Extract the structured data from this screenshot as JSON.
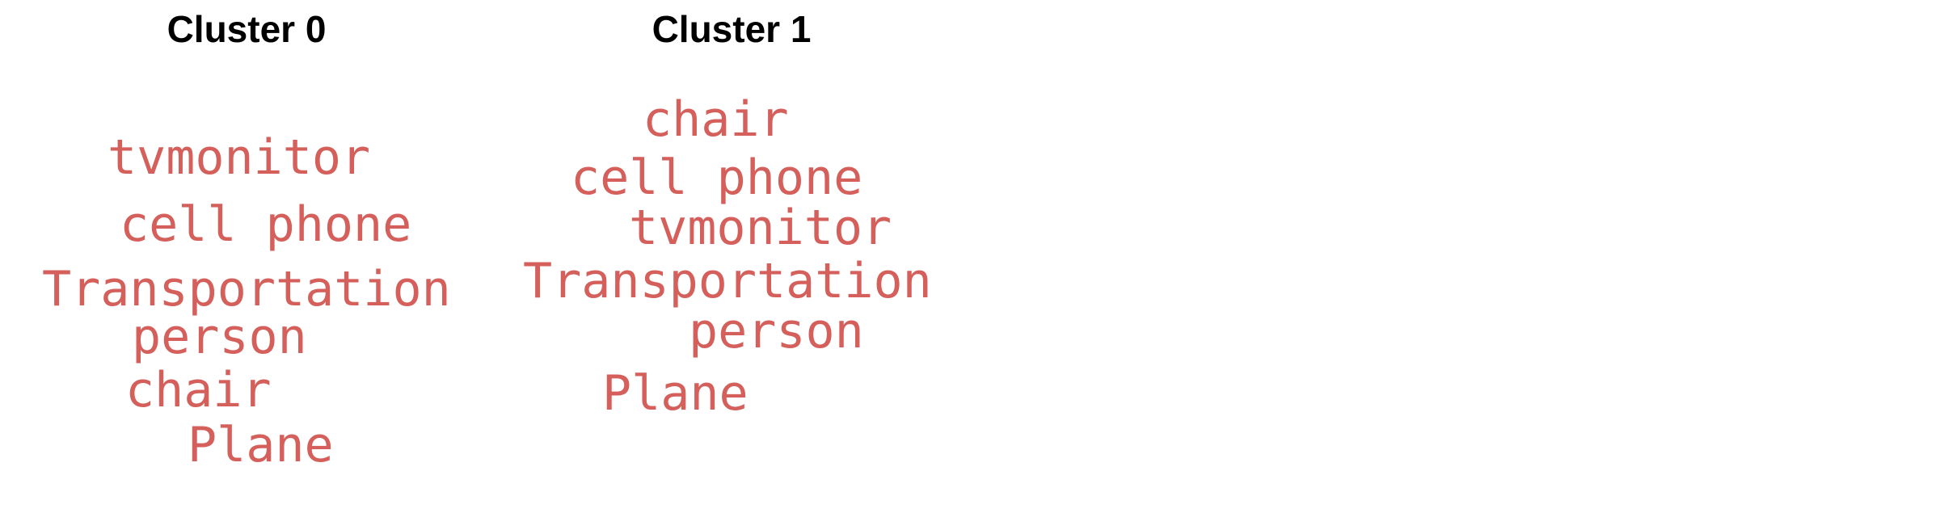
{
  "clusters": [
    {
      "title": "Cluster 0",
      "words": [
        "tvmonitor",
        "cell phone",
        "Transportation",
        "person",
        "chair",
        "Plane"
      ]
    },
    {
      "title": "Cluster 1",
      "words": [
        "chair",
        "cell phone",
        "tvmonitor",
        "Transportation",
        "person",
        "Plane"
      ]
    }
  ],
  "colors": {
    "word": "#d45f5b",
    "title": "#000000",
    "background": "#ffffff"
  }
}
